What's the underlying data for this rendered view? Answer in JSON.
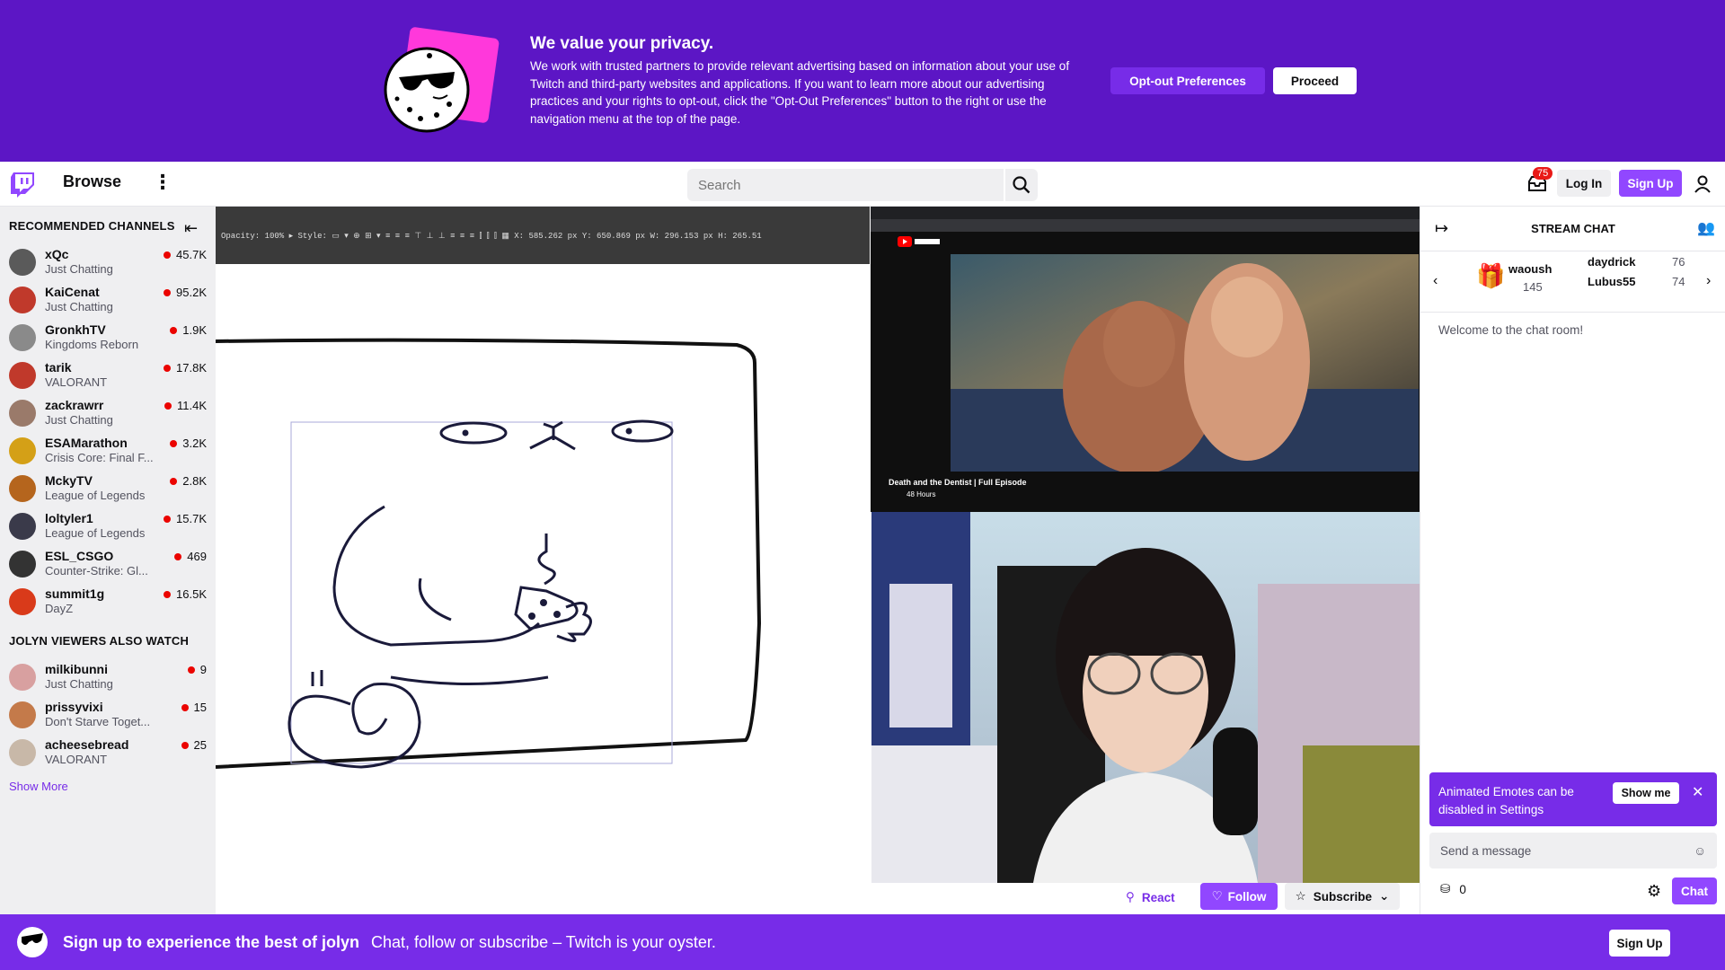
{
  "privacy": {
    "title": "We value your privacy.",
    "body": "We work with trusted partners to provide relevant advertising based on information about your use of Twitch and third-party websites and applications. If you want to learn more about our advertising practices and your rights to opt-out, click the \"Opt-Out Preferences\" button to the right or use the navigation menu at the top of the page.",
    "opt_out_label": "Opt-out Preferences",
    "proceed_label": "Proceed"
  },
  "topnav": {
    "browse": "Browse",
    "search_placeholder": "Search",
    "inbox_count": "75",
    "login": "Log In",
    "signup": "Sign Up"
  },
  "sidebar": {
    "recommended_title": "RECOMMENDED CHANNELS",
    "recommended": [
      {
        "name": "xQc",
        "game": "Just Chatting",
        "viewers": "45.7K",
        "color": "#5a5a5a"
      },
      {
        "name": "KaiCenat",
        "game": "Just Chatting",
        "viewers": "95.2K",
        "color": "#c0392b"
      },
      {
        "name": "GronkhTV",
        "game": "Kingdoms Reborn",
        "viewers": "1.9K",
        "color": "#8a8a8a"
      },
      {
        "name": "tarik",
        "game": "VALORANT",
        "viewers": "17.8K",
        "color": "#c0392b"
      },
      {
        "name": "zackrawrr",
        "game": "Just Chatting",
        "viewers": "11.4K",
        "color": "#9a7a6a"
      },
      {
        "name": "ESAMarathon",
        "game": "Crisis Core: Final F...",
        "viewers": "3.2K",
        "color": "#d4a017"
      },
      {
        "name": "MckyTV",
        "game": "League of Legends",
        "viewers": "2.8K",
        "color": "#b5651d"
      },
      {
        "name": "loltyler1",
        "game": "League of Legends",
        "viewers": "15.7K",
        "color": "#3a3a4a"
      },
      {
        "name": "ESL_CSGO",
        "game": "Counter-Strike: Gl...",
        "viewers": "469",
        "color": "#333333"
      },
      {
        "name": "summit1g",
        "game": "DayZ",
        "viewers": "16.5K",
        "color": "#d93a1a"
      }
    ],
    "also_watch_title": "JOLYN VIEWERS ALSO WATCH",
    "also_watch": [
      {
        "name": "milkibunni",
        "game": "Just Chatting",
        "viewers": "9",
        "color": "#d8a0a0"
      },
      {
        "name": "prissyvixi",
        "game": "Don't Starve Toget...",
        "viewers": "15",
        "color": "#c47a4a"
      },
      {
        "name": "acheesebread",
        "game": "VALORANT",
        "viewers": "25",
        "color": "#c8b8a8"
      }
    ],
    "show_more": "Show More"
  },
  "video": {
    "yt_title": "Death and the Dentist | Full Episode",
    "yt_channel": "48 Hours"
  },
  "streamer": {
    "react": "React",
    "follow": "Follow",
    "subscribe": "Subscribe"
  },
  "chat": {
    "title": "STREAM CHAT",
    "leaderboard": [
      {
        "name": "waoush",
        "count": "145"
      },
      {
        "name": "daydrick",
        "count": "76"
      },
      {
        "name": "Lubus55",
        "count": "74"
      }
    ],
    "welcome": "Welcome to the chat room!",
    "toast_msg": "Animated Emotes can be disabled in Settings",
    "toast_btn": "Show me",
    "input_placeholder": "Send a message",
    "points": "0",
    "chat_btn": "Chat"
  },
  "bottom": {
    "title": "Sign up to experience the best of jolyn",
    "sub": "Chat, follow or subscribe – Twitch is your oyster.",
    "signup": "Sign Up"
  }
}
